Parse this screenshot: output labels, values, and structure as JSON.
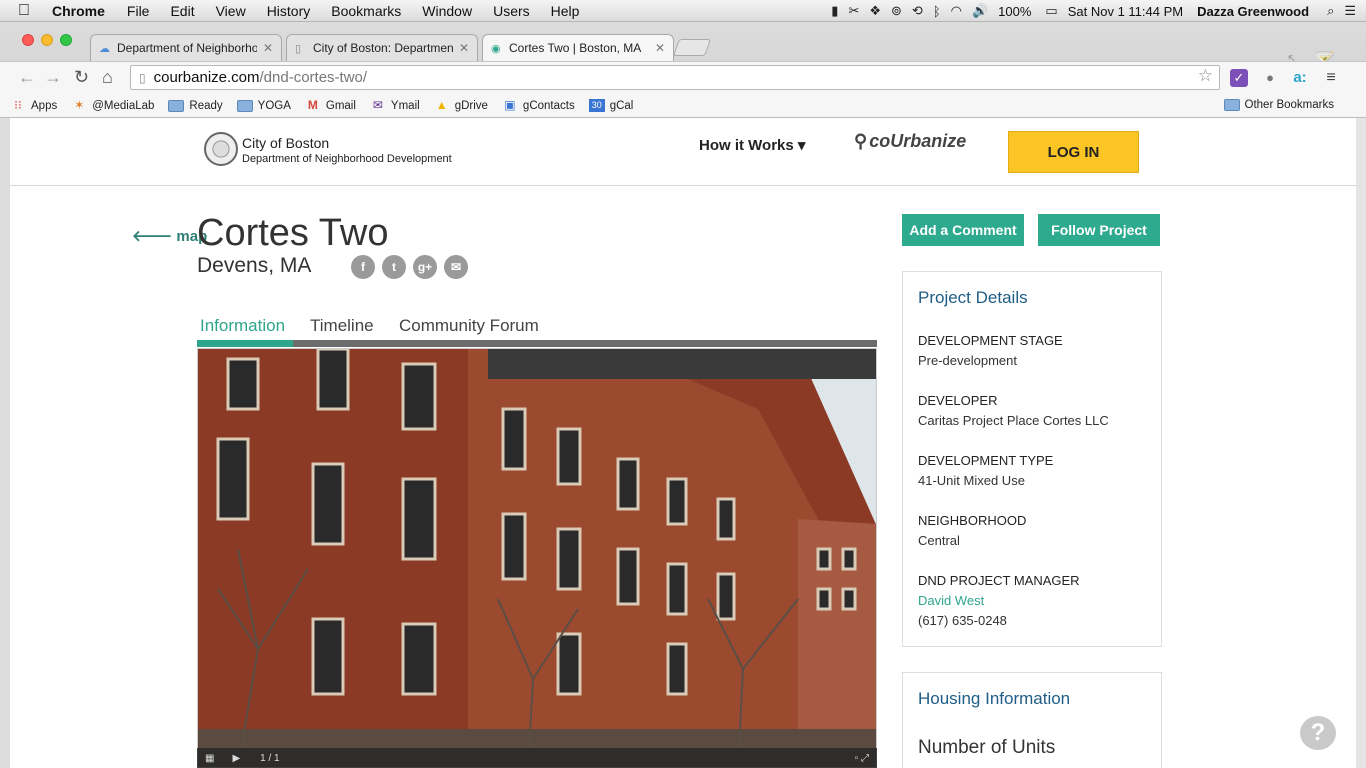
{
  "menubar": {
    "apple": "",
    "app": "Chrome",
    "items": [
      "File",
      "Edit",
      "View",
      "History",
      "Bookmarks",
      "Window",
      "Users",
      "Help"
    ],
    "battery": "100%",
    "clock": "Sat Nov 1  11:44 PM",
    "user": "Dazza Greenwood"
  },
  "browser": {
    "tabs": [
      {
        "label": "Department of Neighborho",
        "active": false
      },
      {
        "label": "City of Boston: Department",
        "active": false
      },
      {
        "label": "Cortes Two | Boston, MA",
        "active": true
      }
    ],
    "url_host": "courbanize.com",
    "url_path": "/dnd-cortes-two/",
    "bookmarks": [
      "Apps",
      "@MediaLab",
      "Ready",
      "YOGA",
      "Gmail",
      "Ymail",
      "gDrive",
      "gContacts",
      "gCal"
    ],
    "gcal_badge": "30",
    "other_bookmarks": "Other Bookmarks"
  },
  "header": {
    "city": "City of Boston",
    "dept": "Department of Neighborhood Development",
    "how_it_works": "How it Works ▾",
    "logo": "coUrbanize",
    "login": "LOG IN"
  },
  "project": {
    "back": "map",
    "title": "Cortes Two",
    "location": "Devens, MA",
    "share_icons": [
      "f",
      "t",
      "g+",
      "✉"
    ],
    "tabs": [
      "Information",
      "Timeline",
      "Community Forum"
    ],
    "gallery_count": "1 / 1"
  },
  "actions": {
    "add_comment": "Add a Comment",
    "follow": "Follow Project"
  },
  "details": {
    "heading": "Project Details",
    "rows": [
      {
        "label": "DEVELOPMENT STAGE",
        "value": "Pre-development"
      },
      {
        "label": "DEVELOPER",
        "value": "Caritas Project Place Cortes LLC"
      },
      {
        "label": "DEVELOPMENT TYPE",
        "value": "41-Unit Mixed Use"
      },
      {
        "label": "NEIGHBORHOOD",
        "value": "Central"
      },
      {
        "label": "DND PROJECT MANAGER",
        "value": "David West",
        "phone": "(617) 635-0248"
      }
    ]
  },
  "housing": {
    "heading": "Housing Information",
    "units_label": "Number of Units"
  },
  "help": "?"
}
